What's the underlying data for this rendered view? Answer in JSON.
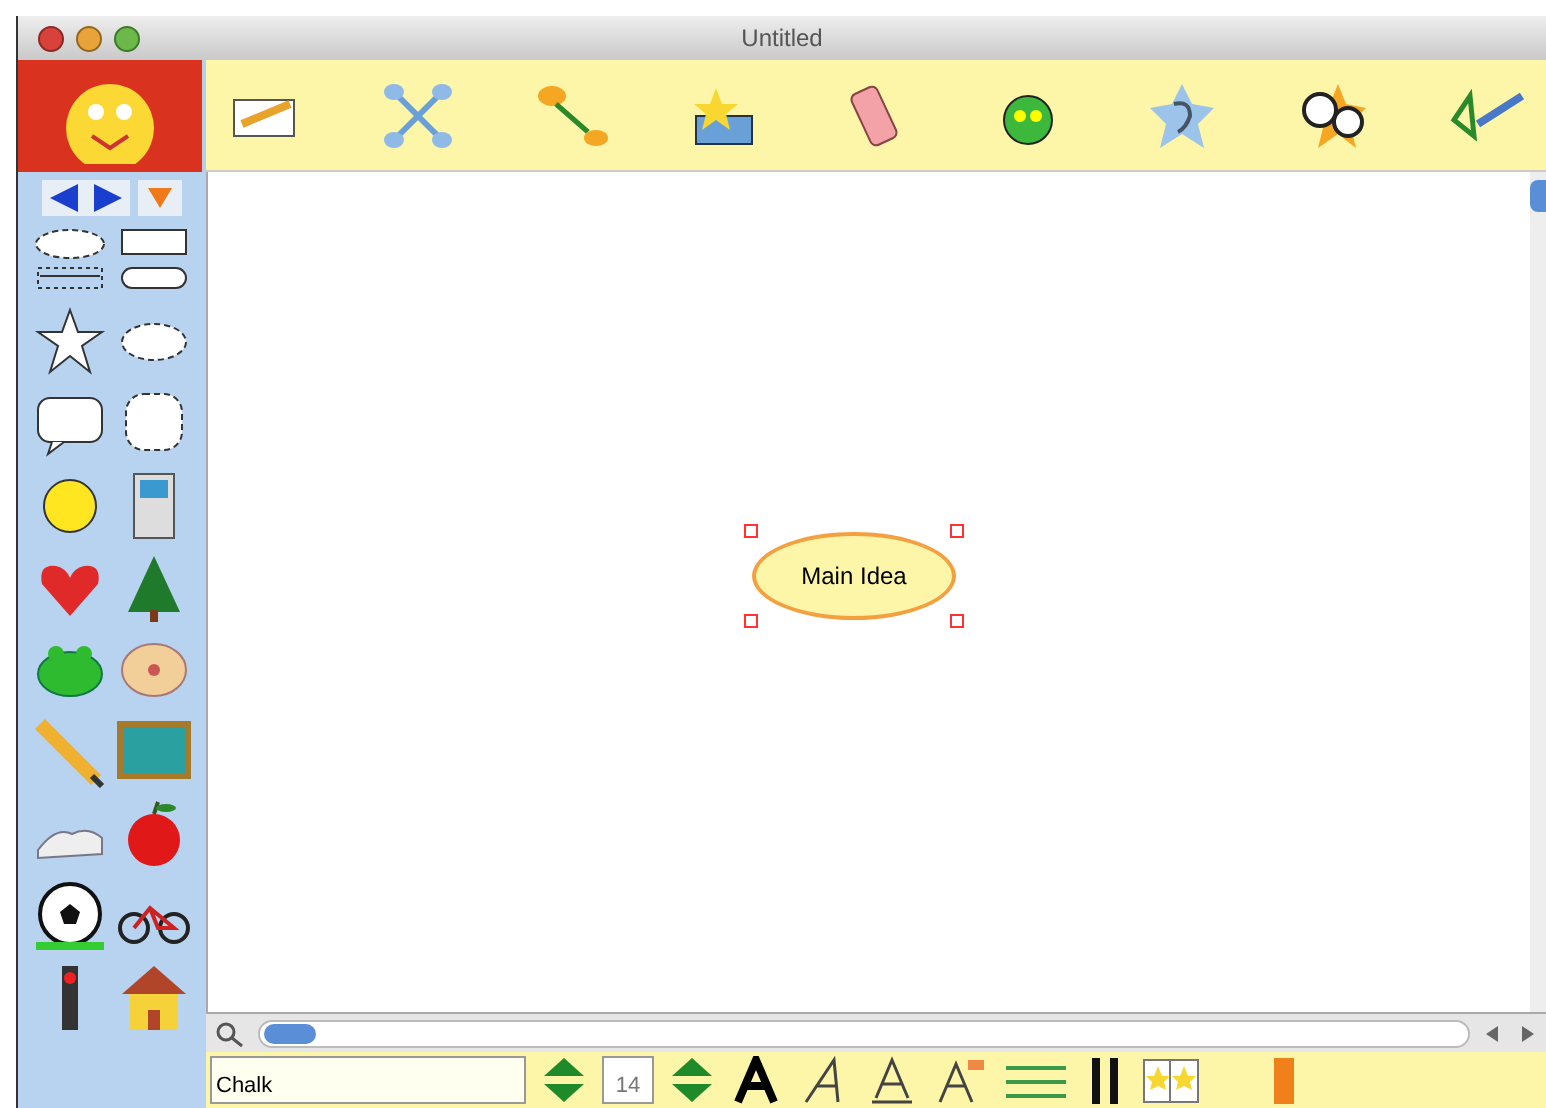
{
  "window": {
    "title": "Untitled"
  },
  "canvas": {
    "nodes": [
      {
        "text": "Main Idea",
        "selected": true
      }
    ]
  },
  "format_bar": {
    "font": "Chalk",
    "size": "14"
  }
}
